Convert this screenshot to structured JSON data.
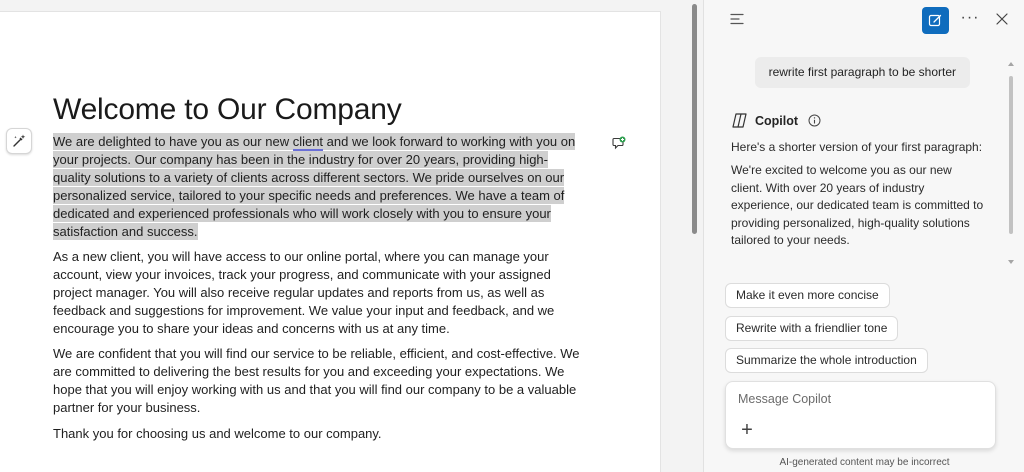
{
  "document": {
    "title": "Welcome to Our Company",
    "paragraphs": {
      "p1": {
        "before_link": "We are delighted to have you as our new ",
        "underlined": "client",
        "after_link": " and we look forward to working with you on your projects. Our company has been in the industry for over 20 years, providing high-quality solutions to a variety of clients across different sectors. We pride ourselves on our personalized service, tailored to your specific needs and preferences. We have a team of dedicated and experienced professionals who will work closely with you to ensure your satisfaction and success."
      },
      "p2": "As a new client, you will have access to our online portal, where you can manage your account, view your invoices, track your progress, and communicate with your assigned project manager. You will also receive regular updates and reports from us, as well as feedback and suggestions for improvement. We value your input and feedback, and we encourage you to share your ideas and concerns with us at any time.",
      "p3": "We are confident that you will find our service to be reliable, efficient, and cost-effective. We are committed to delivering the best results for you and exceeding your expectations. We hope that you will enjoy working with us and that you will find our company to be a valuable partner for your business.",
      "p4": "Thank you for choosing us and welcome to our company."
    }
  },
  "copilot": {
    "user_message": "rewrite first paragraph to be shorter",
    "assistant_name": "Copilot",
    "response_intro": "Here's a shorter version of your first paragraph:",
    "response_body": "We're excited to welcome you as our new client. With over 20 years of industry experience, our dedicated team is committed to providing personalized, high-quality solutions tailored to your needs.",
    "suggestions": [
      "Make it even more concise",
      "Rewrite with a friendlier tone",
      "Summarize the whole introduction"
    ],
    "composer_placeholder": "Message Copilot",
    "disclaimer": "AI-generated content may be incorrect",
    "more_glyph": "···"
  },
  "icons": {
    "rewrite": "pen-sparkle-icon",
    "comment": "comment-add-icon",
    "menu": "hamburger-icon",
    "compose": "new-chat-icon",
    "more": "more-icon",
    "close": "close-icon",
    "logo": "copilot-logo-icon",
    "info": "info-icon",
    "plus": "plus-icon"
  },
  "colors": {
    "accent": "#0f6cbd",
    "selection": "#cfcfcf",
    "underline": "#6a6fd8",
    "comment_badge": "#2e9e4f"
  }
}
